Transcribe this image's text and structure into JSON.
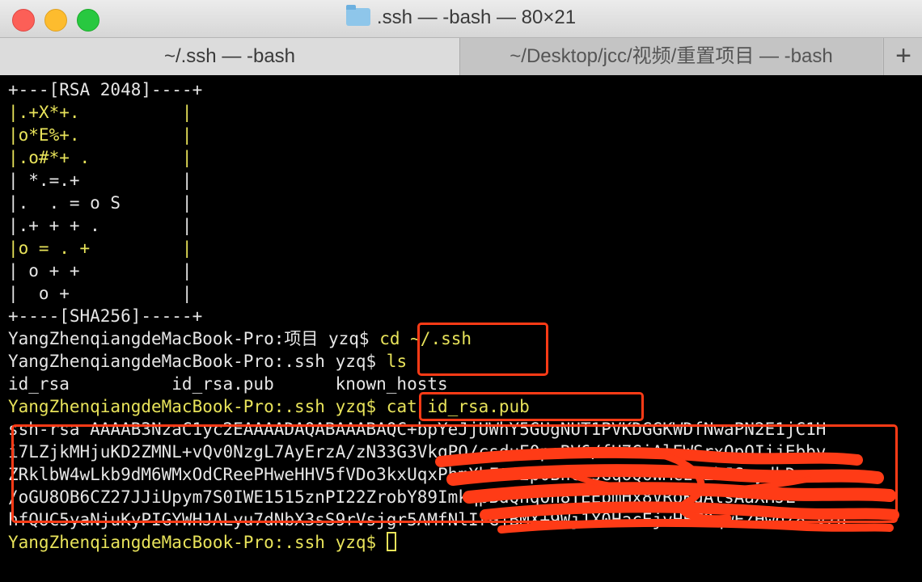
{
  "window": {
    "title": ".ssh — -bash — 80×21",
    "tabs": [
      {
        "label": "~/.ssh — -bash",
        "active": true
      },
      {
        "label": "~/Desktop/jcc/视频/重置项目 — -bash",
        "active": false
      }
    ],
    "add_tab_icon": "plus-icon"
  },
  "terminal": {
    "randomart": [
      "+---[RSA 2048]----+",
      "|.+X*+.          |",
      "|o*E%+.          |",
      "|.o#*+ .         |",
      "| *.=.+          |",
      "|.  . = o S      |",
      "|.+ + + .        |",
      "|o = . +         |",
      "| o + +          |",
      "|  o +           |",
      "+----[SHA256]-----+"
    ],
    "prompts": [
      {
        "prompt": "YangZhenqiangdeMacBook-Pro:项目 yzq$ ",
        "command": "cd ~/.ssh"
      },
      {
        "prompt": "YangZhenqiangdeMacBook-Pro:.ssh yzq$ ",
        "command": "ls"
      },
      {
        "prompt": "YangZhenqiangdeMacBook-Pro:.ssh yzq$ ",
        "command": "cat id_rsa.pub"
      }
    ],
    "ls_output": "id_rsa          id_rsa.pub      known_hosts",
    "pubkey_lines": [
      "ssh-rsa AAAAB3NzaC1yc2EAAAADAQABAAABAQC+bpYeJjUWhY5GUgNUT1PVKDGGKWDfNwaPN2E1jC1H",
      "i7LZjkMHjuKD2ZMNL+vQv0NzgL7AyErzA/zN33G3VkqPQ/csduE0peBV6/fH7GiAlEWSrxQpQIijEbbv",
      "ZRklbW4wLkb9dM6WMxOdCReePHweHHV5fVDo3kxUqxPhmXbFtF2p0BncZsGqoQ6WMczvZhJSeydhD",
      "/oGU8OB6CZ27JJiUpym7S0IWE1515znPI22ZrobY89ImkqpBdQnqOn8TEEbmHx8VRoKdAlsAaXHJL",
      "hfQUC5yaNjuKyPIGYWHJALyu7dNbX3sS9rVsjgr5AMfNlIrGjBMX+9Wj1X0HacEjvHBZ9qwEZHwqZ8 yzq"
    ],
    "final_prompt": "YangZhenqiangdeMacBook-Pro:.ssh yzq$ "
  }
}
